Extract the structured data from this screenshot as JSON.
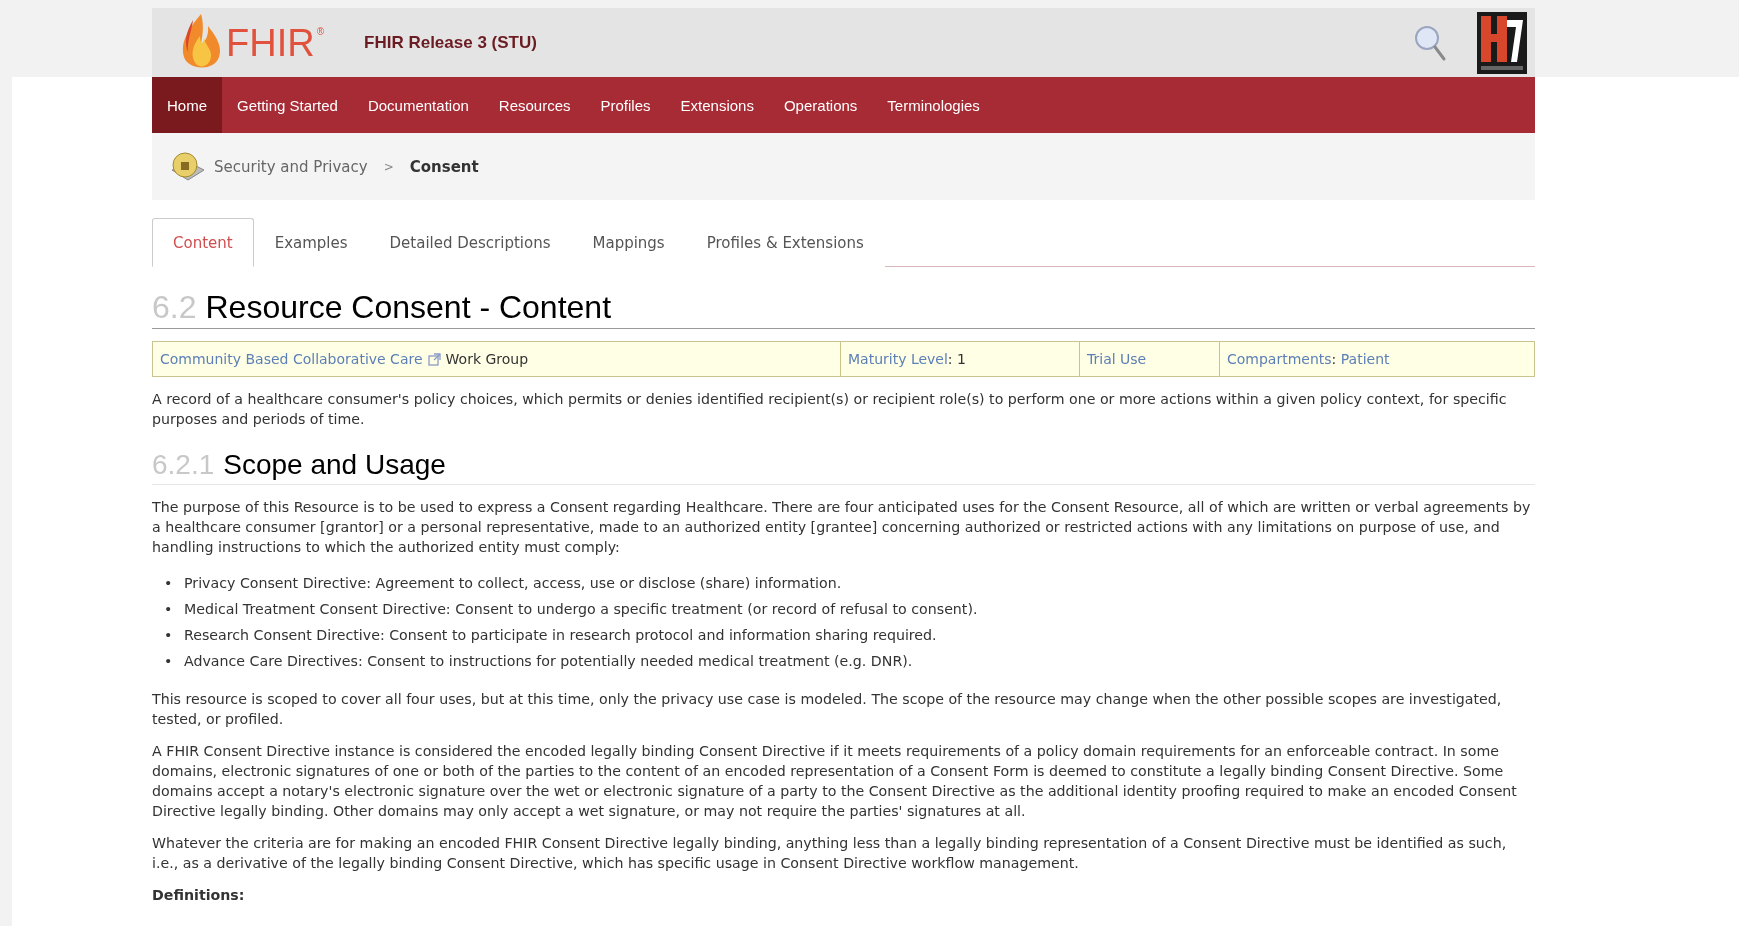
{
  "header": {
    "logo": {
      "text": "FHIR",
      "mark": "®"
    },
    "release": "FHIR Release 3 (STU)"
  },
  "nav": [
    {
      "label": "Home",
      "selected": true
    },
    {
      "label": "Getting Started",
      "selected": false
    },
    {
      "label": "Documentation",
      "selected": false
    },
    {
      "label": "Resources",
      "selected": false
    },
    {
      "label": "Profiles",
      "selected": false
    },
    {
      "label": "Extensions",
      "selected": false
    },
    {
      "label": "Operations",
      "selected": false
    },
    {
      "label": "Terminologies",
      "selected": false
    }
  ],
  "breadcrumb": [
    {
      "label": "Security and Privacy",
      "kind": "link"
    },
    {
      "label": "Consent",
      "kind": "current"
    }
  ],
  "breadcrumb_separator": ">",
  "tabs": [
    {
      "label": "Content",
      "selected": true
    },
    {
      "label": "Examples",
      "selected": false
    },
    {
      "label": "Detailed Descriptions",
      "selected": false
    },
    {
      "label": "Mappings",
      "selected": false
    },
    {
      "label": "Profiles & Extensions",
      "selected": false
    }
  ],
  "title": {
    "number": "6.2",
    "text": "Resource Consent - Content"
  },
  "info_table": [
    {
      "parts": [
        {
          "kind": "link",
          "text": "Community Based Collaborative Care"
        },
        {
          "kind": "external"
        },
        {
          "kind": "text",
          "text": "Work Group"
        }
      ]
    },
    {
      "parts": [
        {
          "kind": "link",
          "text": "Maturity Level"
        },
        {
          "kind": "text",
          "text": ": 1"
        }
      ]
    },
    {
      "parts": [
        {
          "kind": "link",
          "text": "Trial Use"
        }
      ]
    },
    {
      "parts": [
        {
          "kind": "link",
          "text": "Compartments"
        },
        {
          "kind": "text",
          "text": ": "
        },
        {
          "kind": "link",
          "text": "Patient"
        }
      ]
    }
  ],
  "summary": "A record of a healthcare consumer's policy choices, which permits or denies identified recipient(s) or recipient role(s) to perform one or more actions within a given policy context, for specific purposes and periods of time.",
  "section": {
    "number": "6.2.1",
    "title": "Scope and Usage"
  },
  "blocks": [
    {
      "kind": "paragraph",
      "text": "The purpose of this Resource is to be used to express a Consent regarding Healthcare. There are four anticipated uses for the Consent Resource, all of which are written or verbal agreements by a healthcare consumer [grantor] or a personal representative, made to an authorized entity [grantee] concerning authorized or restricted actions with any limitations on purpose of use, and handling instructions to which the authorized entity must comply:"
    },
    {
      "kind": "list",
      "bullet": "•",
      "items": [
        "Privacy Consent Directive: Agreement to collect, access, use or disclose (share) information.",
        "Medical Treatment Consent Directive: Consent to undergo a specific treatment (or record of refusal to consent).",
        "Research Consent Directive: Consent to participate in research protocol and information sharing required.",
        "Advance Care Directives: Consent to instructions for potentially needed medical treatment (e.g. DNR)."
      ]
    },
    {
      "kind": "paragraph",
      "text": "This resource is scoped to cover all four uses, but at this time, only the privacy use case is modeled. The scope of the resource may change when the other possible scopes are investigated, tested, or profiled."
    },
    {
      "kind": "paragraph",
      "text": "A FHIR Consent Directive instance is considered the encoded legally binding Consent Directive if it meets requirements of a policy domain requirements for an enforceable contract. In some domains, electronic signatures of one or both of the parties to the content of an encoded representation of a Consent Form is deemed to constitute a legally binding Consent Directive. Some domains accept a notary's electronic signature over the wet or electronic signature of a party to the Consent Directive as the additional identity proofing required to make an encoded Consent Directive legally binding. Other domains may only accept a wet signature, or may not require the parties' signatures at all."
    },
    {
      "kind": "paragraph",
      "text": "Whatever the criteria are for making an encoded FHIR Consent Directive legally binding, anything less than a legally binding representation of a Consent Directive must be identified as such, i.e., as a derivative of the legally binding Consent Directive, which has specific usage in Consent Directive workflow management."
    },
    {
      "kind": "heading",
      "text": "Definitions:"
    }
  ]
}
